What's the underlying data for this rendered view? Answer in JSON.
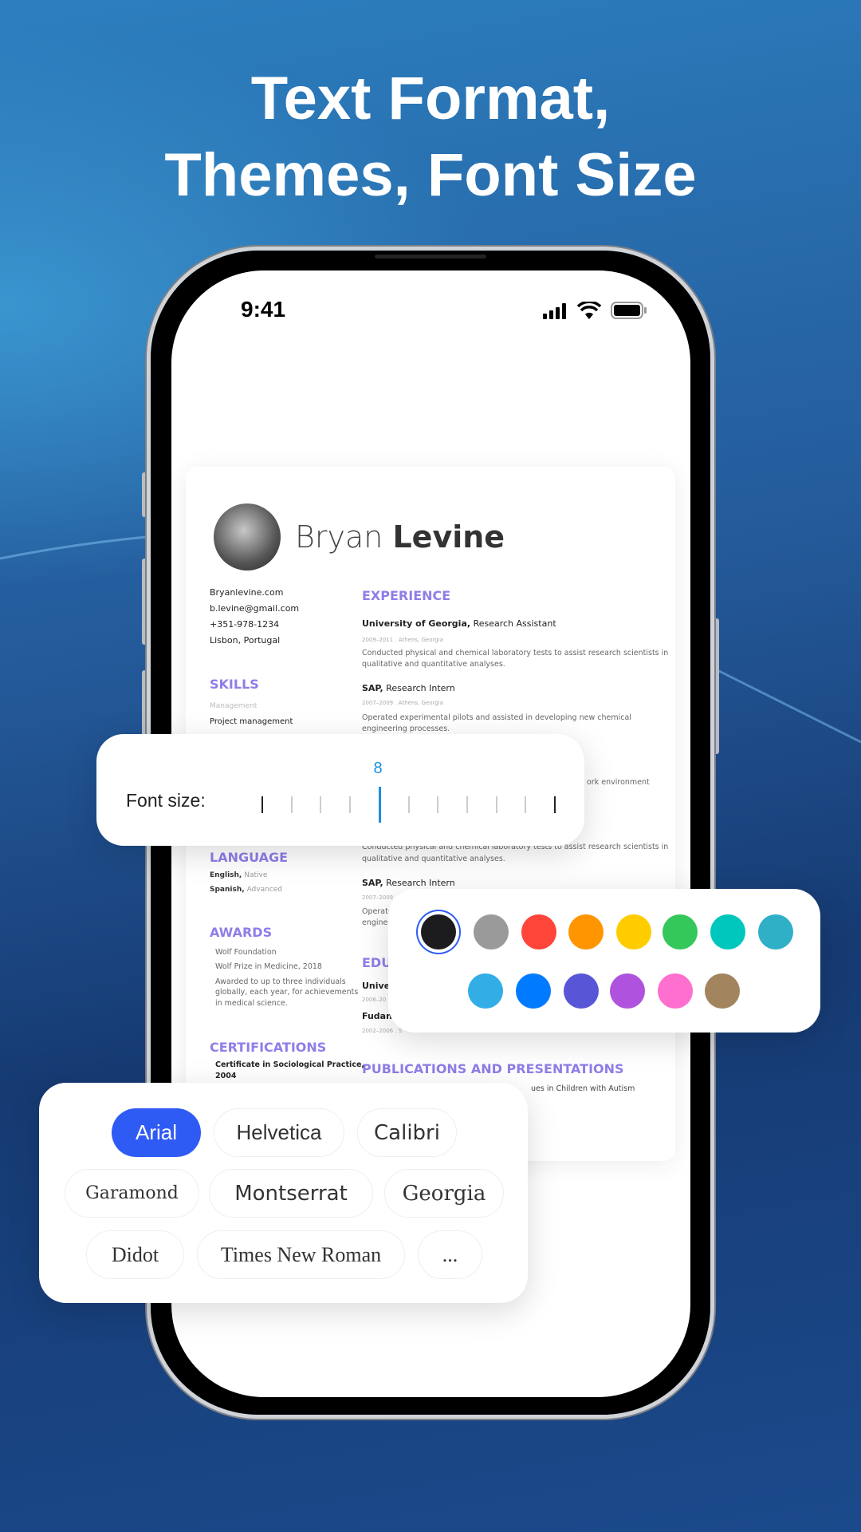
{
  "headline": {
    "line1": "Text Format,",
    "line2": "Themes, Font Size"
  },
  "status_bar": {
    "time": "9:41"
  },
  "resume": {
    "first_name": "Bryan",
    "last_name": "Levine",
    "contacts": [
      "Bryanlevine.com",
      "b.levine@gmail.com",
      "+351-978-1234",
      "Lisbon, Portugal"
    ],
    "skills": {
      "title": "SKILLS",
      "category": "Management",
      "item": "Project management"
    },
    "language": {
      "title": "LANGUAGE",
      "items": [
        {
          "lang": "English,",
          "level": "Native"
        },
        {
          "lang": "Spanish,",
          "level": "Advanced"
        }
      ]
    },
    "awards": {
      "title": "AWARDS",
      "items": [
        "Wolf Foundation",
        "Wolf Prize in Medicine, 2018",
        "Awarded to up to three individuals",
        "globally, each year, for achievements",
        "in medical science."
      ]
    },
    "certifications": {
      "title": "CERTIFICATIONS",
      "items": [
        "Certificate in Sociological Practice,",
        "2004"
      ]
    },
    "experience": {
      "title": "EXPERIENCE",
      "jobs": [
        {
          "org": "University of Georgia,",
          "role": "Research Assistant",
          "date": "2009–2011 . Athens, Georgia",
          "desc1": "Conducted physical and chemical laboratory tests to assist research scientists in",
          "desc2": "qualitative and quantitative analyses."
        },
        {
          "org": "SAP,",
          "role": "Research Intern",
          "date": "2007–2009 . Athens, Georgia",
          "desc1": "Operated experimental pilots and assisted in developing new chemical",
          "desc2": "engineering processes."
        }
      ],
      "partial": "ork environment",
      "job3": {
        "desc1": "Conducted physical and chemical laboratory tests to assist research scientists in",
        "desc2": "qualitative and quantitative analyses."
      },
      "job4": {
        "org": "SAP,",
        "role": "Research Intern",
        "date": "2007–2009",
        "desc1": "Operate",
        "desc2": "enginee"
      }
    },
    "education": {
      "title": "EDU",
      "items": [
        {
          "org": "Unive",
          "date": "2006–20"
        },
        {
          "org": "Fudan",
          "date": "2002–2006 . S"
        }
      ]
    },
    "publications": {
      "title": "PUBLICATIONS AND PRESENTATIONS",
      "item": "ues in Children with Autism"
    }
  },
  "font_size": {
    "label": "Font size:",
    "value": "8",
    "selected_index": 4,
    "tick_count": 11,
    "accent": "#1a8fe0"
  },
  "colors": {
    "selected": 0,
    "row1": [
      "#1c1c1e",
      "#9a9a9a",
      "#ff453a",
      "#ff9500",
      "#ffcc00",
      "#34c759",
      "#00c7be",
      "#30b0c7"
    ],
    "row2": [
      "#32ade6",
      "#007aff",
      "#5856d6",
      "#af52de",
      "#ff6fcf",
      "#a2845e"
    ],
    "ring": "#2f5bf5"
  },
  "fonts": {
    "selected": "Arial",
    "accent": "#2f5bf5",
    "rows": [
      [
        "Arial",
        "Helvetica",
        "Calibri"
      ],
      [
        "Garamond",
        "Montserrat",
        "Georgia"
      ],
      [
        "Didot",
        "Times New Roman",
        "..."
      ]
    ]
  }
}
